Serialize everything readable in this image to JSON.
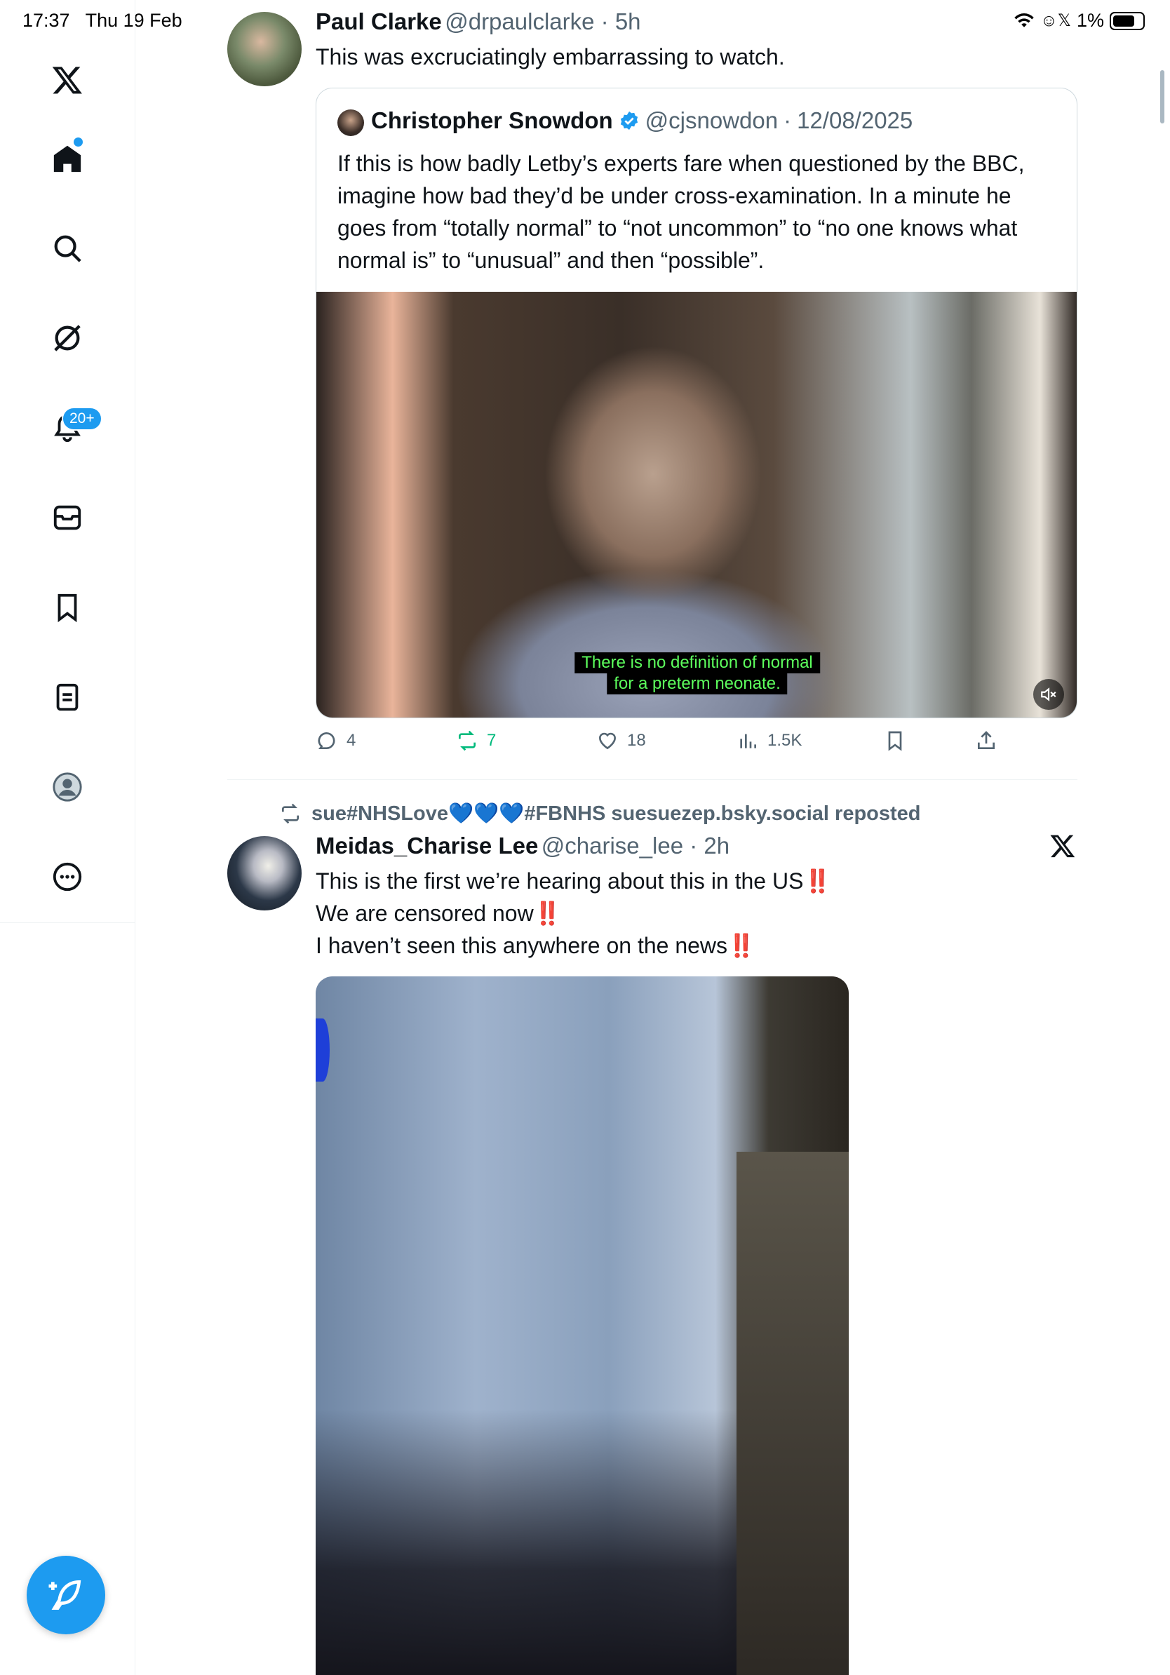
{
  "status_bar": {
    "time": "17:37",
    "date": "Thu 19 Feb",
    "battery": "1%"
  },
  "sidebar": {
    "items": [
      {
        "name": "x-logo-icon"
      },
      {
        "name": "home-icon"
      },
      {
        "name": "search-icon"
      },
      {
        "name": "grok-icon"
      },
      {
        "name": "notifications-icon"
      },
      {
        "name": "messages-icon"
      },
      {
        "name": "bookmarks-icon"
      },
      {
        "name": "lists-icon"
      },
      {
        "name": "profile-icon"
      },
      {
        "name": "more-icon"
      }
    ],
    "notification_badge": "20+"
  },
  "tweets": [
    {
      "author_name": "Paul Clarke",
      "author_handle": "@drpaulclarke",
      "time": "5h",
      "text": "This was excruciatingly embarrassing to watch.",
      "quote": {
        "author_name": "Christopher Snowdon",
        "verified": true,
        "author_handle": "@cjsnowdon",
        "time": "12/08/2025",
        "text": "If this is how badly Letby’s experts fare when questioned by the BBC, imagine how bad they’d be under cross-examination. In a minute he goes from “totally normal” to “not uncommon” to “no one knows what normal is” to “unusual” and then “possible”.",
        "video_subtitle_1": "There is no definition of normal",
        "video_subtitle_2": "for a preterm neonate."
      },
      "stats": {
        "replies": "4",
        "reposts": "7",
        "likes": "18",
        "views": "1.5K"
      }
    },
    {
      "reposted_by": "sue#NHSLove💙💙💙#FBNHS suesuezep.bsky.social reposted",
      "author_name": "Meidas_Charise Lee",
      "author_handle": "@charise_lee",
      "time": "2h",
      "line1": "This is the first we’re hearing about this in the US",
      "line2": "We are censored now",
      "line3": "I haven’t seen this anywhere on the news",
      "emphasis": "‼️"
    }
  ],
  "colors": {
    "accent": "#1d9bf0",
    "repost_green": "#00ba7c",
    "muted_text": "#536471"
  }
}
